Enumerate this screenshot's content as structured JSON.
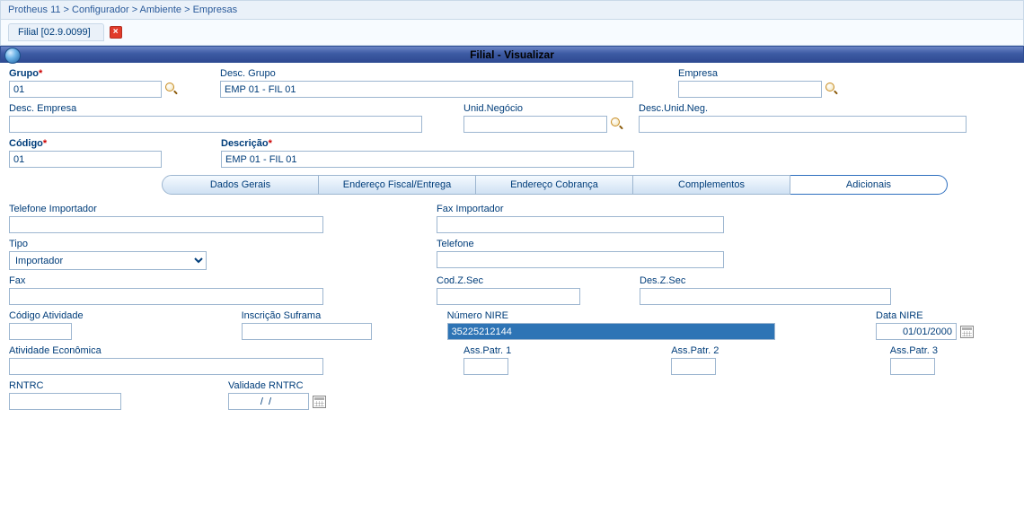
{
  "breadcrumb": "Protheus 11 > Configurador > Ambiente > Empresas",
  "docTab": {
    "label": "Filial [02.9.0099]",
    "close": "×"
  },
  "titlebar": "Filial - Visualizar",
  "top": {
    "grupo_label": "Grupo",
    "grupo_value": "01",
    "descgrupo_label": "Desc. Grupo",
    "descgrupo_value": "EMP 01 - FIL 01",
    "empresa_label": "Empresa",
    "empresa_value": "",
    "descempresa_label": "Desc. Empresa",
    "descempresa_value": "",
    "unidnegocio_label": "Unid.Negócio",
    "unidnegocio_value": "",
    "descunidneg_label": "Desc.Unid.Neg.",
    "descunidneg_value": "",
    "codigo_label": "Código",
    "codigo_value": "01",
    "descricao_label": "Descrição",
    "descricao_value": "EMP 01 - FIL 01"
  },
  "tabs": {
    "dados_gerais": "Dados Gerais",
    "endereco_fiscal": "Endereço Fiscal/Entrega",
    "endereco_cobranca": "Endereço Cobrança",
    "complementos": "Complementos",
    "adicionais": "Adicionais"
  },
  "adicionais": {
    "tel_importador_label": "Telefone Importador",
    "tel_importador_value": "",
    "fax_importador_label": "Fax Importador",
    "fax_importador_value": "",
    "tipo_label": "Tipo",
    "tipo_selected": "Importador",
    "telefone_label": "Telefone",
    "telefone_value": "",
    "fax_label": "Fax",
    "fax_value": "",
    "codzsec_label": "Cod.Z.Sec",
    "codzsec_value": "",
    "deszsec_label": "Des.Z.Sec",
    "deszsec_value": "",
    "codatividade_label": "Código Atividade",
    "codatividade_value": "",
    "insc_suframa_label": "Inscrição Suframa",
    "insc_suframa_value": "",
    "numero_nire_label": "Número NIRE",
    "numero_nire_value": "35225212144",
    "data_nire_label": "Data NIRE",
    "data_nire_value": "01/01/2000",
    "atividade_econ_label": "Atividade Econômica",
    "atividade_econ_value": "",
    "asspatr1_label": "Ass.Patr. 1",
    "asspatr1_value": "",
    "asspatr2_label": "Ass.Patr. 2",
    "asspatr2_value": "",
    "asspatr3_label": "Ass.Patr. 3",
    "asspatr3_value": "",
    "rntrc_label": "RNTRC",
    "rntrc_value": "",
    "validade_rntrc_label": "Validade RNTRC",
    "validade_rntrc_value": "  /  /    "
  }
}
